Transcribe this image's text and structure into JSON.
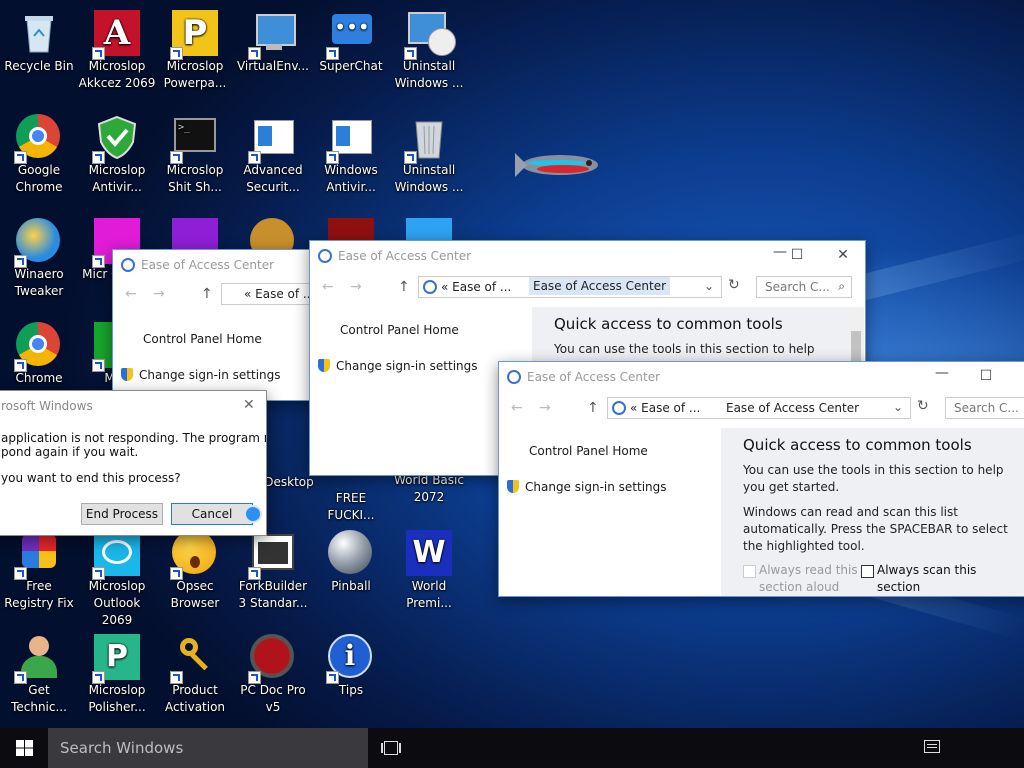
{
  "desktop": {
    "icons": [
      {
        "label": "Recycle Bin",
        "icon": "recycle-bin-icon"
      },
      {
        "label": "Microslop Akkcez 2069",
        "icon": "access-icon"
      },
      {
        "label": "Microslop Powerpa...",
        "icon": "powerpoint-icon"
      },
      {
        "label": "VirtualEnv...",
        "icon": "computer-icon"
      },
      {
        "label": "SuperChat",
        "icon": "chat-icon"
      },
      {
        "label": "Uninstall Windows ...",
        "icon": "uninstall-disc-icon"
      },
      {
        "label": "Google Chrome",
        "icon": "chrome-icon"
      },
      {
        "label": "Microslop Antivir...",
        "icon": "shield-check-icon"
      },
      {
        "label": "Microslop Shit Sh...",
        "icon": "terminal-icon"
      },
      {
        "label": "Advanced Securit...",
        "icon": "window-icon"
      },
      {
        "label": "Windows Antivir...",
        "icon": "window-icon"
      },
      {
        "label": "Uninstall Windows ...",
        "icon": "trash-can-icon"
      },
      {
        "label": "Winaero Tweaker",
        "icon": "winaero-icon"
      },
      {
        "label": "Micr Cock...",
        "icon": "magenta-app-icon"
      },
      {
        "label": "Chrome",
        "icon": "chrome-icon"
      },
      {
        "label": "Micr",
        "icon": "green-app-icon"
      },
      {
        "label": "FREE FUCKI...",
        "icon": "desktop-file-icon"
      },
      {
        "label": "World Basic 2072",
        "icon": "desktop-file-icon"
      },
      {
        "label": "Desktop",
        "icon": "desktop-file-icon"
      },
      {
        "label": "Free Registry Fix",
        "icon": "registry-fix-icon"
      },
      {
        "label": "Microslop Outlook 2069",
        "icon": "outlook-icon"
      },
      {
        "label": "Opsec Browser",
        "icon": "surprised-face-icon"
      },
      {
        "label": "ForkBuilder 3 Standar...",
        "icon": "window-frame-icon"
      },
      {
        "label": "Pinball",
        "icon": "pinball-icon"
      },
      {
        "label": "World Premi...",
        "icon": "world-premium-icon"
      },
      {
        "label": "Get Technic...",
        "icon": "support-person-icon"
      },
      {
        "label": "Microslop Polisher...",
        "icon": "polisher-icon"
      },
      {
        "label": "Product Activation",
        "icon": "key-icon"
      },
      {
        "label": "PC Doc Pro v5",
        "icon": "pc-doc-icon"
      },
      {
        "label": "Tips",
        "icon": "info-icon"
      }
    ]
  },
  "window1": {
    "title": "Ease of Access Center",
    "breadcrumb": "« Ease of ...",
    "links": [
      "Control Panel Home",
      "Change sign-in settings"
    ]
  },
  "window2": {
    "title": "Ease of Access Center",
    "breadcrumb_prefix": "« Ease of ...",
    "breadcrumb_current": "Ease of Access Center",
    "search_placeholder": "Search C...",
    "links": [
      "Control Panel Home",
      "Change sign-in settings"
    ],
    "heading": "Quick access to common tools",
    "intro": "You can use the tools in this section to help"
  },
  "window3": {
    "title": "Ease of Access Center",
    "breadcrumb_prefix": "« Ease of ...",
    "breadcrumb_current": "Ease of Access Center",
    "search_placeholder": "Search C...",
    "links": [
      "Control Panel Home",
      "Change sign-in settings"
    ],
    "heading": "Quick access to common tools",
    "intro": "You can use the tools in this section to help you get started.",
    "scan_text": "Windows can read and scan this list automatically.  Press the SPACEBAR to select the highlighted tool.",
    "checkbox_read": "Always read this section aloud",
    "checkbox_scan": "Always scan this section"
  },
  "dialog": {
    "title": "rosoft Windows",
    "message1": "application is not responding. The program may",
    "message2": "pond again if you wait.",
    "message3": "you want to end this process?",
    "end_process": "End Process",
    "cancel": "Cancel"
  },
  "taskbar": {
    "search_placeholder": "Search Windows"
  }
}
